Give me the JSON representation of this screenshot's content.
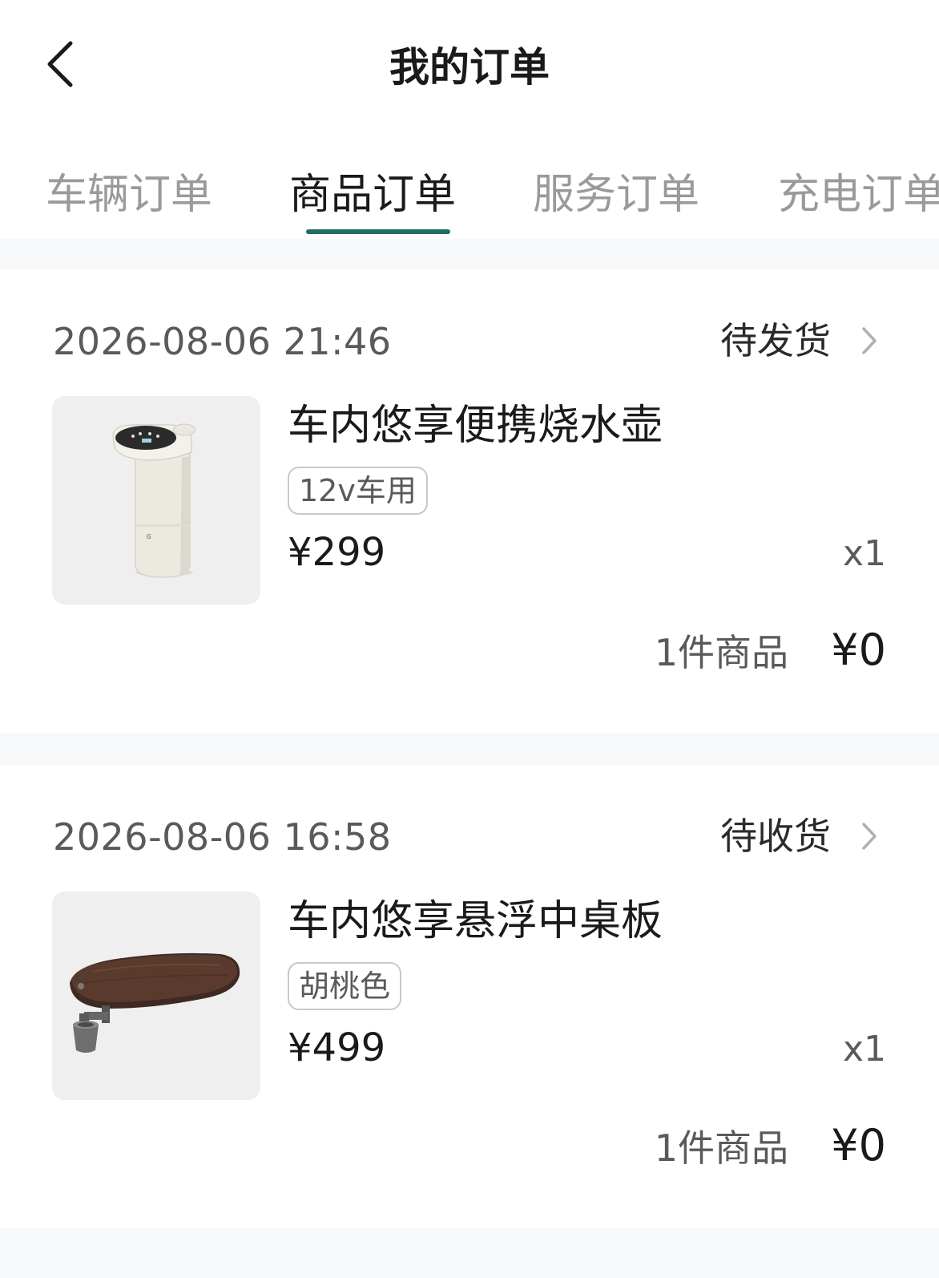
{
  "header": {
    "title": "我的订单",
    "back_icon": "chevron-left-icon"
  },
  "tabs": [
    {
      "label": "车辆订单",
      "active": false
    },
    {
      "label": "商品订单",
      "active": true
    },
    {
      "label": "服务订单",
      "active": false
    },
    {
      "label": "充电订单",
      "active": false
    }
  ],
  "colors": {
    "accent": "#1f6e62",
    "background": "#f7f8fa",
    "inactive_tab": "#9a9a9a"
  },
  "orders": [
    {
      "time": "2026-08-06 21:46",
      "status": "待发货",
      "product_name": "车内悠享便携烧水壶",
      "variant": "12v车用",
      "price": "¥299",
      "quantity": "x1",
      "item_count": "1件商品",
      "total": "¥0",
      "image_icon": "portable-kettle-image"
    },
    {
      "time": "2026-08-06 16:58",
      "status": "待收货",
      "product_name": "车内悠享悬浮中桌板",
      "variant": "胡桃色",
      "price": "¥499",
      "quantity": "x1",
      "item_count": "1件商品",
      "total": "¥0",
      "image_icon": "floating-table-image"
    }
  ]
}
